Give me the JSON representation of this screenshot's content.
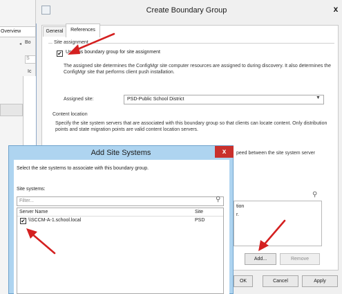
{
  "background_app": {
    "tab_label": "Overview",
    "collapse_arrow": "◂",
    "fragment_1": "Bo",
    "fragment_2": "S",
    "fragment_3": "Ic"
  },
  "dialog": {
    "title": "Create Boundary Group",
    "close_glyph": "x",
    "tabs": [
      {
        "label": "General"
      },
      {
        "label": "References"
      }
    ],
    "site_assignment": {
      "group_label": "Site assignment",
      "checkbox_label": "Use this boundary group for site assignment",
      "checked": true,
      "description": "The assigned site determines the ConfigMgr site computer resources are assigned to during discovery. It also determines the ConfigMgr site that performs client push installation.",
      "assigned_site_label": "Assigned site:",
      "assigned_site_value": "PSD-Public School District"
    },
    "content_location": {
      "group_label": "Content location",
      "description": "Specify the site system servers that are associated with this boundary group so that clients can locate content. Only distribution points and state migration points are valid content location servers.",
      "partial_text": "peed between the site system server",
      "table_fragment_1": "tion",
      "table_fragment_2": "r."
    },
    "buttons": {
      "add": "Add...",
      "remove": "Remove",
      "ok": "OK",
      "cancel": "Cancel",
      "apply": "Apply"
    }
  },
  "add_site_systems": {
    "title": "Add Site Systems",
    "close_glyph": "x",
    "instruction": "Select the site systems to associate with this boundary group.",
    "site_systems_label": "Site systems:",
    "filter_placeholder": "Filter...",
    "columns": [
      "Server Name",
      "Site"
    ],
    "rows": [
      {
        "server": "\\\\SCCM-A-1.school.local",
        "site": "PSD",
        "checked": true
      }
    ]
  },
  "colors": {
    "annotation_arrow": "#d42020",
    "close_button": "#c9302c",
    "subdialog_frame": "#aed4f0"
  }
}
